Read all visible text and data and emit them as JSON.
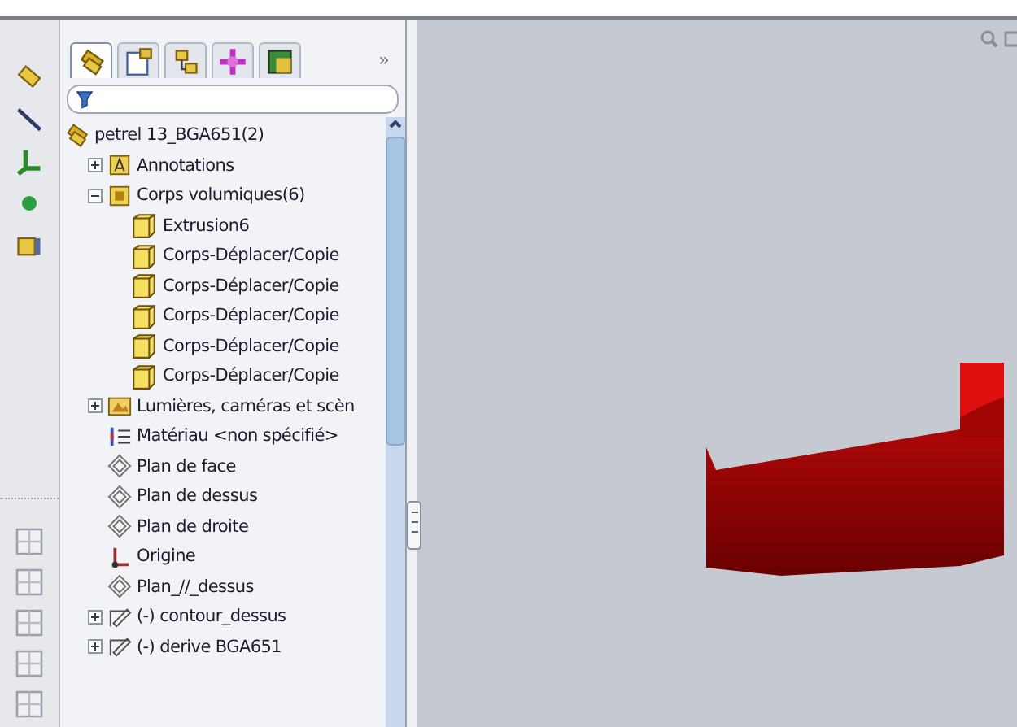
{
  "panel_tabs": [
    {
      "kind": "features",
      "selected": true
    },
    {
      "kind": "properties",
      "selected": false
    },
    {
      "kind": "configurations",
      "selected": false
    },
    {
      "kind": "dimxpert",
      "selected": false
    },
    {
      "kind": "display",
      "selected": false
    }
  ],
  "more_tabs": "»",
  "filter": {
    "kind": "filter"
  },
  "tree": {
    "label": "petrel 13_BGA651(2)",
    "kind": "part",
    "children": [
      {
        "label": "Annotations",
        "kind": "annotations",
        "expanded": false
      },
      {
        "label": "Corps volumiques(6)",
        "kind": "bodies",
        "expanded": true,
        "children": [
          {
            "label": "Extrusion6",
            "kind": "body"
          },
          {
            "label": "Corps-Déplacer/Copie",
            "kind": "body"
          },
          {
            "label": "Corps-Déplacer/Copie",
            "kind": "body"
          },
          {
            "label": "Corps-Déplacer/Copie",
            "kind": "body"
          },
          {
            "label": "Corps-Déplacer/Copie",
            "kind": "body"
          },
          {
            "label": "Corps-Déplacer/Copie",
            "kind": "body"
          }
        ]
      },
      {
        "label": "Lumières, caméras et scèn",
        "kind": "lights",
        "expanded": false
      },
      {
        "label": "Matériau <non spécifié>",
        "kind": "material"
      },
      {
        "label": "Plan de face",
        "kind": "plane"
      },
      {
        "label": "Plan de dessus",
        "kind": "plane"
      },
      {
        "label": "Plan de droite",
        "kind": "plane"
      },
      {
        "label": "Origine",
        "kind": "origin"
      },
      {
        "label": "Plan_//_dessus",
        "kind": "plane"
      },
      {
        "label": "(-) contour_dessus",
        "kind": "sketch",
        "expanded": false
      },
      {
        "label": "(-) derive BGA651",
        "kind": "sketch",
        "expanded": false
      }
    ]
  }
}
